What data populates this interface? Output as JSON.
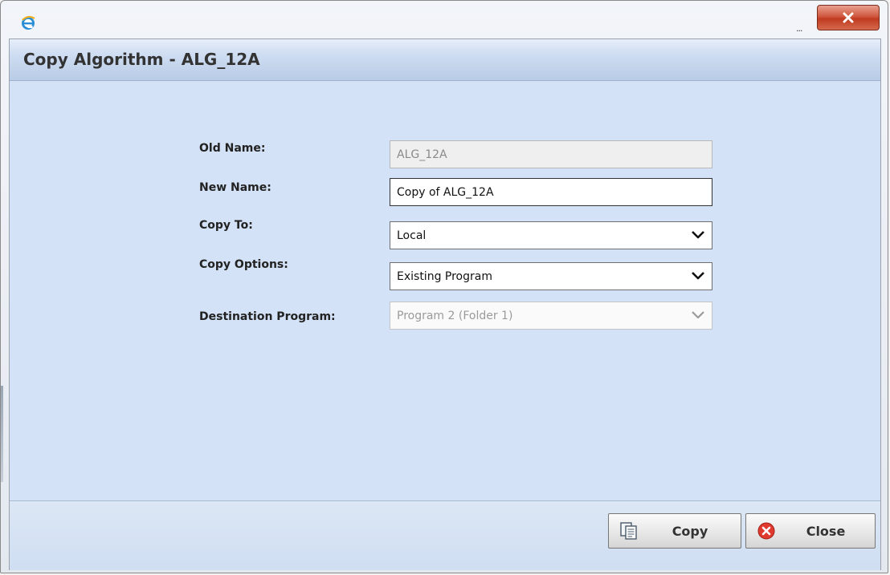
{
  "dialog": {
    "title": "Copy Algorithm - ALG_12A",
    "titlebar_ellipsis": "..."
  },
  "form": {
    "old_name": {
      "label": "Old Name:",
      "value": "ALG_12A"
    },
    "new_name": {
      "label": "New Name:",
      "value": "Copy of ALG_12A"
    },
    "copy_to": {
      "label": "Copy To:",
      "value": "Local"
    },
    "copy_options": {
      "label": "Copy Options:",
      "value": "Existing Program"
    },
    "destination_program": {
      "label": "Destination Program:",
      "value": "Program 2 (Folder 1)"
    }
  },
  "buttons": {
    "copy": "Copy",
    "close": "Close"
  },
  "icons": {
    "app": "internet-explorer-icon",
    "window_close": "close-x-icon",
    "copy": "copy-documents-icon",
    "close": "red-circle-x-icon",
    "dropdown": "chevron-down-icon"
  },
  "colors": {
    "body_bg": "#d3e2f6",
    "close_button": "#c8462a"
  }
}
